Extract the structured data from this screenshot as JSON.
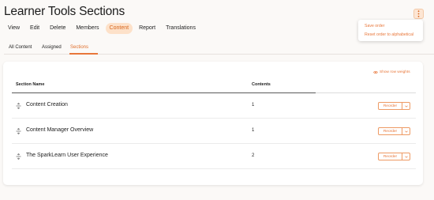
{
  "page": {
    "title": "Learner Tools Sections"
  },
  "header_menu": {
    "icon": "kebab-menu-icon",
    "items": [
      "Save order",
      "Reset order to alphabetical"
    ]
  },
  "topnav": {
    "items": [
      "View",
      "Edit",
      "Delete",
      "Members",
      "Content",
      "Report",
      "Translations"
    ],
    "active": "Content"
  },
  "subtabs": {
    "items": [
      "All Content",
      "Assigned",
      "Sections"
    ],
    "active": "Sections"
  },
  "table": {
    "show_weights_label": "Show row weights",
    "columns": [
      "Section Name",
      "Contents"
    ],
    "rows": [
      {
        "name": "Content Creation",
        "contents": "1",
        "action": "Reorder"
      },
      {
        "name": "Content Manager Overview",
        "contents": "1",
        "action": "Reorder"
      },
      {
        "name": "The SparkLearn User Experience",
        "contents": "2",
        "action": "Reorder"
      }
    ]
  },
  "colors": {
    "accent": "#e8773a",
    "active_pill_bg": "#fde1c9",
    "page_bg": "#fbf9f7"
  }
}
